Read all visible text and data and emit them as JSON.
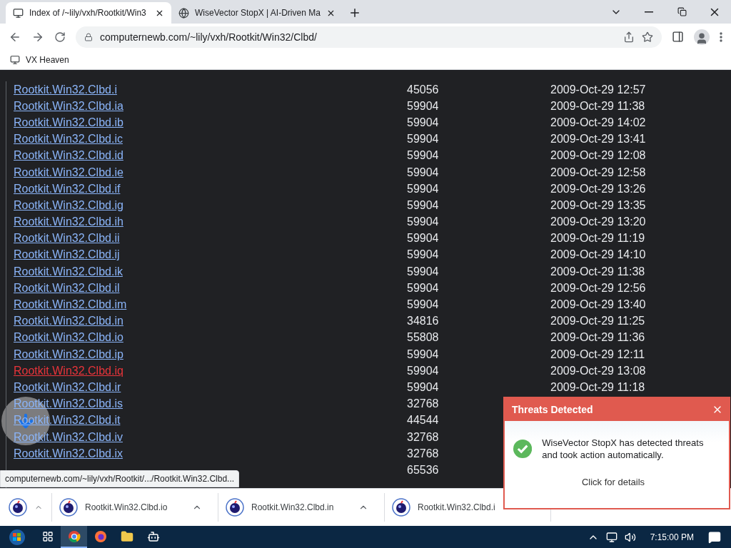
{
  "tabs": [
    {
      "title": "Index of /~lily/vxh/Rootkit/Win3",
      "selected": true
    },
    {
      "title": "WiseVector StopX | AI-Driven Ma",
      "selected": false
    }
  ],
  "address": "computernewb.com/~lily/vxh/Rootkit/Win32/Clbd/",
  "bookmarks": [
    {
      "label": "VX Heaven"
    }
  ],
  "files": [
    {
      "name": "Rootkit.Win32.Clbd.i",
      "size": "45056",
      "date": "2009-Oct-29 12:57",
      "hovered": false
    },
    {
      "name": "Rootkit.Win32.Clbd.ia",
      "size": "59904",
      "date": "2009-Oct-29 11:38",
      "hovered": false
    },
    {
      "name": "Rootkit.Win32.Clbd.ib",
      "size": "59904",
      "date": "2009-Oct-29 14:02",
      "hovered": false
    },
    {
      "name": "Rootkit.Win32.Clbd.ic",
      "size": "59904",
      "date": "2009-Oct-29 13:41",
      "hovered": false
    },
    {
      "name": "Rootkit.Win32.Clbd.id",
      "size": "59904",
      "date": "2009-Oct-29 12:08",
      "hovered": false
    },
    {
      "name": "Rootkit.Win32.Clbd.ie",
      "size": "59904",
      "date": "2009-Oct-29 12:58",
      "hovered": false
    },
    {
      "name": "Rootkit.Win32.Clbd.if",
      "size": "59904",
      "date": "2009-Oct-29 13:26",
      "hovered": false
    },
    {
      "name": "Rootkit.Win32.Clbd.ig",
      "size": "59904",
      "date": "2009-Oct-29 13:35",
      "hovered": false
    },
    {
      "name": "Rootkit.Win32.Clbd.ih",
      "size": "59904",
      "date": "2009-Oct-29 13:20",
      "hovered": false
    },
    {
      "name": "Rootkit.Win32.Clbd.ii",
      "size": "59904",
      "date": "2009-Oct-29 11:19",
      "hovered": false
    },
    {
      "name": "Rootkit.Win32.Clbd.ij",
      "size": "59904",
      "date": "2009-Oct-29 14:10",
      "hovered": false
    },
    {
      "name": "Rootkit.Win32.Clbd.ik",
      "size": "59904",
      "date": "2009-Oct-29 11:38",
      "hovered": false
    },
    {
      "name": "Rootkit.Win32.Clbd.il",
      "size": "59904",
      "date": "2009-Oct-29 12:56",
      "hovered": false
    },
    {
      "name": "Rootkit.Win32.Clbd.im",
      "size": "59904",
      "date": "2009-Oct-29 13:40",
      "hovered": false
    },
    {
      "name": "Rootkit.Win32.Clbd.in",
      "size": "34816",
      "date": "2009-Oct-29 11:25",
      "hovered": false
    },
    {
      "name": "Rootkit.Win32.Clbd.io",
      "size": "55808",
      "date": "2009-Oct-29 11:36",
      "hovered": false
    },
    {
      "name": "Rootkit.Win32.Clbd.ip",
      "size": "59904",
      "date": "2009-Oct-29 12:11",
      "hovered": false
    },
    {
      "name": "Rootkit.Win32.Clbd.iq",
      "size": "59904",
      "date": "2009-Oct-29 13:08",
      "hovered": true
    },
    {
      "name": "Rootkit.Win32.Clbd.ir",
      "size": "59904",
      "date": "2009-Oct-29 11:18",
      "hovered": false
    },
    {
      "name": "Rootkit.Win32.Clbd.is",
      "size": "32768",
      "hovered": false
    },
    {
      "name": "Rootkit.Win32.Clbd.it",
      "size": "44544",
      "hovered": false
    },
    {
      "name": "Rootkit.Win32.Clbd.iv",
      "size": "32768",
      "hovered": false
    },
    {
      "name": "Rootkit.Win32.Clbd.ix",
      "size": "32768",
      "hovered": false
    },
    {
      "size": "65536"
    }
  ],
  "status_url": "computernewb.com/~lily/vxh/Rootkit/.../Rootkit.Win32.Clbd...",
  "downloads": [
    {
      "name": "Rootkit.Win32.Clbd.io"
    },
    {
      "name": "Rootkit.Win32.Clbd.in"
    },
    {
      "name": "Rootkit.Win32.Clbd.i"
    }
  ],
  "notification": {
    "title": "Threats Detected",
    "message": "WiseVector StopX has detected threats and took action automatically.",
    "link": "Click for details"
  },
  "taskbar": {
    "apps": [
      {
        "kind": "taskview",
        "active": false
      },
      {
        "kind": "chrome",
        "active": true
      },
      {
        "kind": "firefox",
        "active": false
      },
      {
        "kind": "explorer",
        "active": false
      },
      {
        "kind": "robot",
        "active": false
      }
    ],
    "clock": "7:15:00 PM"
  }
}
